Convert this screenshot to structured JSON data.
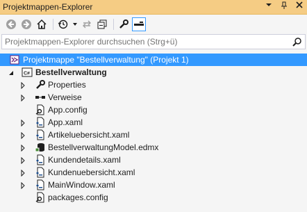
{
  "window": {
    "title": "Projektmappen-Explorer",
    "actions": [
      "dropdown-icon",
      "pin-icon",
      "close-icon"
    ]
  },
  "toolbar": {
    "buttons": [
      "back-icon",
      "forward-icon",
      "home-icon",
      "history-icon",
      "sync-icon",
      "collapse-all-icon",
      "properties-icon",
      "preview-icon"
    ]
  },
  "search": {
    "placeholder": "Projektmappen-Explorer durchsuchen (Strg+ü)"
  },
  "tree": {
    "solution_label": "Projektmappe \"Bestellverwaltung\" (Projekt 1)",
    "project_label": "Bestellverwaltung",
    "items": [
      {
        "label": "Properties",
        "icon": "wrench-icon",
        "expandable": true
      },
      {
        "label": "Verweise",
        "icon": "references-icon",
        "expandable": true
      },
      {
        "label": "App.config",
        "icon": "config-file-icon",
        "expandable": false
      },
      {
        "label": "App.xaml",
        "icon": "xaml-file-icon",
        "expandable": true
      },
      {
        "label": "Artikeluebersicht.xaml",
        "icon": "xaml-file-icon",
        "expandable": true
      },
      {
        "label": "BestellverwaltungModel.edmx",
        "icon": "edmx-file-icon",
        "expandable": true
      },
      {
        "label": "Kundendetails.xaml",
        "icon": "xaml-file-icon",
        "expandable": true
      },
      {
        "label": "Kundenuebersicht.xaml",
        "icon": "xaml-file-icon",
        "expandable": true
      },
      {
        "label": "MainWindow.xaml",
        "icon": "xaml-file-icon",
        "expandable": true
      },
      {
        "label": "packages.config",
        "icon": "config-file-icon",
        "expandable": false
      }
    ]
  },
  "colors": {
    "title_bg": "#f5cc84",
    "selection": "#3399ff",
    "background": "#f5f5f5"
  }
}
